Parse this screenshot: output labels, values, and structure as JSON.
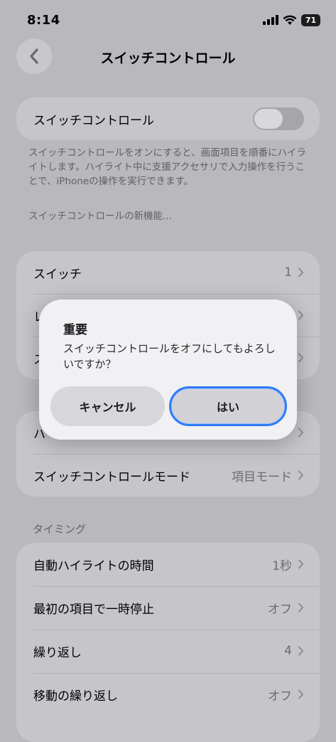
{
  "status": {
    "time": "8:14",
    "battery": "71"
  },
  "nav": {
    "title": "スイッチコントロール"
  },
  "main_toggle": {
    "label": "スイッチコントロール",
    "on": false
  },
  "description": "スイッチコントロールをオンにすると、画面項目を順番にハイライトします。ハイライト中に支援アクセサリで入力操作を行うことで、iPhoneの操作を実行できます。",
  "whats_new": "スイッチコントロールの新機能...",
  "group1": [
    {
      "label": "スイッチ",
      "value": "1"
    },
    {
      "label": "レ",
      "value": ""
    },
    {
      "label": "ス",
      "value": ""
    }
  ],
  "group2": [
    {
      "label": "ハ",
      "value": ""
    },
    {
      "label": "スイッチコントロールモード",
      "value": "項目モード"
    }
  ],
  "timing": {
    "header": "タイミング",
    "rows": [
      {
        "label": "自動ハイライトの時間",
        "value": "1秒"
      },
      {
        "label": "最初の項目で一時停止",
        "value": "オフ"
      },
      {
        "label": "繰り返し",
        "value": "4"
      },
      {
        "label": "移動の繰り返し",
        "value": "オフ"
      }
    ]
  },
  "dialog": {
    "title": "重要",
    "message": "スイッチコントロールをオフにしてもよろしいですか？",
    "cancel": "キャンセル",
    "confirm": "はい"
  }
}
